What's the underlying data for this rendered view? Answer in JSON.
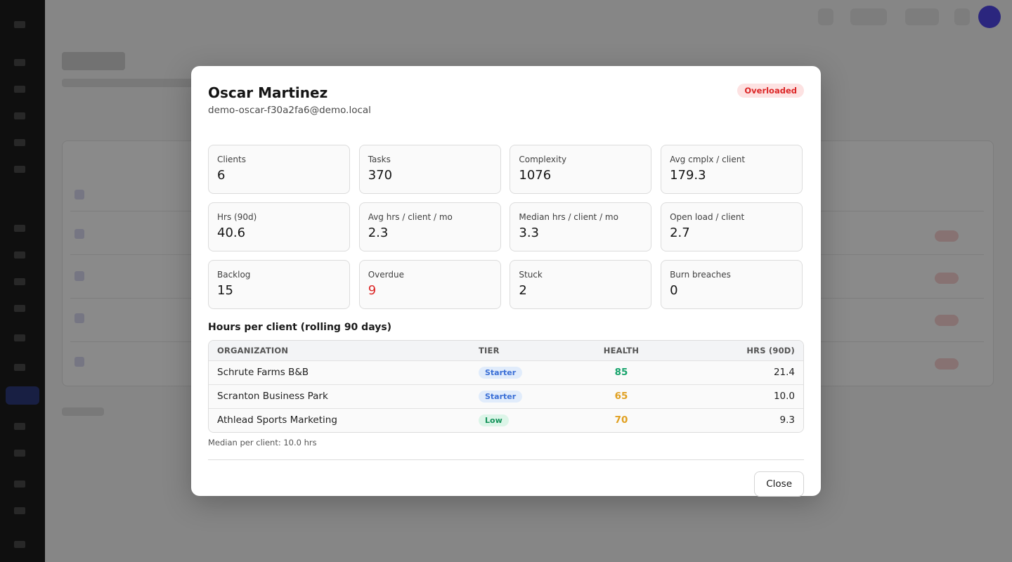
{
  "modal": {
    "title": "Oscar Martinez",
    "email": "demo-oscar-f30a2fa6@demo.local",
    "status": "Overloaded",
    "stats": [
      {
        "label": "Clients",
        "value": "6"
      },
      {
        "label": "Tasks",
        "value": "370"
      },
      {
        "label": "Complexity",
        "value": "1076"
      },
      {
        "label": "Avg cmplx / client",
        "value": "179.3"
      },
      {
        "label": "Hrs (90d)",
        "value": "40.6"
      },
      {
        "label": "Avg hrs / client / mo",
        "value": "2.3"
      },
      {
        "label": "Median hrs / client / mo",
        "value": "3.3"
      },
      {
        "label": "Open load / client",
        "value": "2.7"
      },
      {
        "label": "Backlog",
        "value": "15"
      },
      {
        "label": "Overdue",
        "value": "9"
      },
      {
        "label": "Stuck",
        "value": "2"
      },
      {
        "label": "Burn breaches",
        "value": "0"
      }
    ],
    "section_title": "Hours per client (rolling 90 days)",
    "table": {
      "headers": [
        "ORGANIZATION",
        "TIER",
        "HEALTH",
        "HRS (90D)"
      ],
      "rows": [
        {
          "organization": "Schrute Farms B&B",
          "tier": "Starter",
          "health": "85",
          "hours": "21.4"
        },
        {
          "organization": "Scranton Business Park",
          "tier": "Starter",
          "health": "65",
          "hours": "10.0"
        },
        {
          "organization": "Athlead Sports Marketing",
          "tier": "Low",
          "health": "70",
          "hours": "9.3"
        }
      ]
    },
    "median_note": "Median per client: 10.0 hrs",
    "close_label": "Close"
  },
  "colors": {
    "danger": "#dc2626",
    "health_good": "#16a36b",
    "health_warn": "#e0a021",
    "tier_starter": "#3b6fd6",
    "tier_low": "#15935a",
    "avatar": "#4f46e5"
  }
}
